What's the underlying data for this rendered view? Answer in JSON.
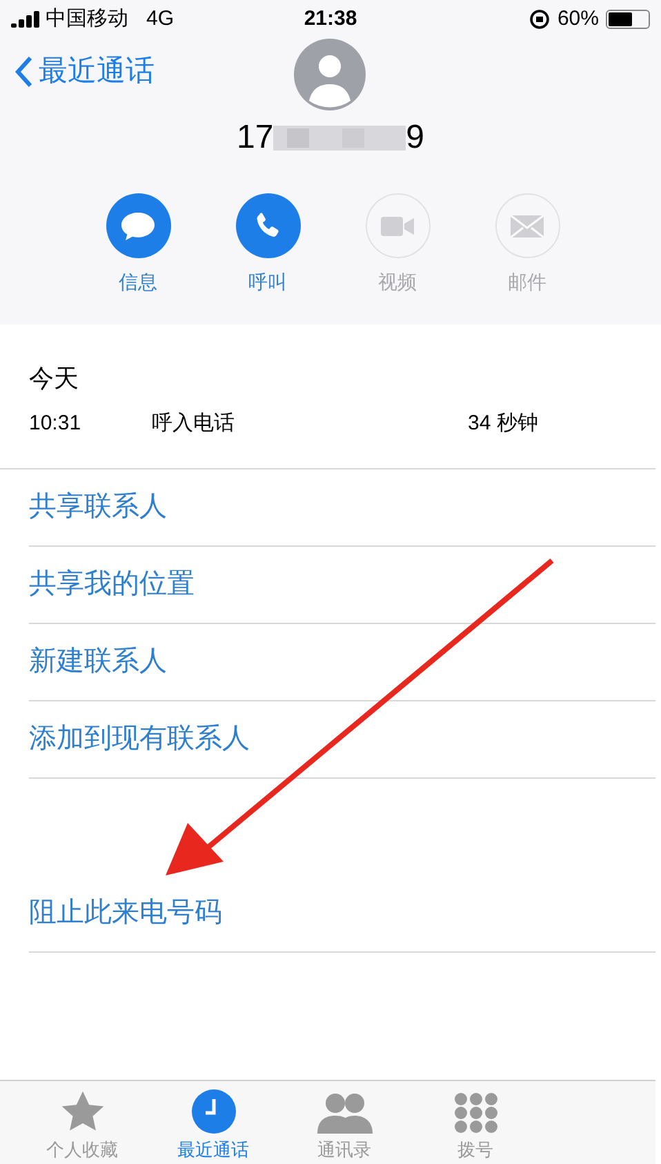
{
  "status_bar": {
    "carrier": "中国移动",
    "network": "4G",
    "time": "21:38",
    "battery": "60%"
  },
  "header": {
    "back_label": "最近通话",
    "number_start": "17",
    "number_end": "9"
  },
  "actions": [
    {
      "label": "信息",
      "disabled": false
    },
    {
      "label": "呼叫",
      "disabled": false
    },
    {
      "label": "视频",
      "disabled": true
    },
    {
      "label": "邮件",
      "disabled": true
    }
  ],
  "call_log": {
    "date": "今天",
    "entries": [
      {
        "time": "10:31",
        "type": "呼入电话",
        "duration": "34 秒钟"
      }
    ]
  },
  "options": [
    "共享联系人",
    "共享我的位置",
    "新建联系人",
    "添加到现有联系人"
  ],
  "block_option": "阻止此来电号码",
  "tabs": [
    {
      "label": "个人收藏",
      "selected": false
    },
    {
      "label": "最近通话",
      "selected": true
    },
    {
      "label": "通讯录",
      "selected": false
    },
    {
      "label": "拨号",
      "selected": false
    }
  ]
}
